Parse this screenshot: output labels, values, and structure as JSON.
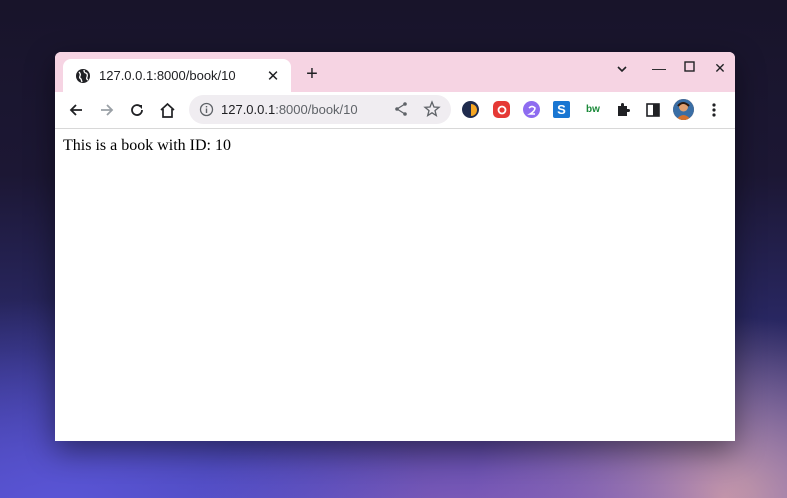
{
  "tab": {
    "title": "127.0.0.1:8000/book/10",
    "favicon": "globe-icon",
    "close_glyph": "✕"
  },
  "newtab_glyph": "+",
  "window_controls": {
    "dropdown": "chevron-down-icon",
    "minimize": "—",
    "maximize": "▢",
    "close": "✕"
  },
  "toolbar": {
    "back": "back-arrow-icon",
    "forward": "forward-arrow-icon",
    "reload": "reload-icon",
    "home": "home-icon"
  },
  "omnibox": {
    "host": "127.0.0.1",
    "path": ":8000/book/10"
  },
  "extensions": [
    {
      "name": "extension-1-icon",
      "color": "#1f2b4d"
    },
    {
      "name": "extension-2-icon",
      "color": "#e53935"
    },
    {
      "name": "extension-3-icon",
      "color": "#8e6cf0"
    },
    {
      "name": "extension-4-icon",
      "color": "#1976d2",
      "label": "S"
    },
    {
      "name": "extension-5-icon",
      "color": "#1b8a3a",
      "label": "bw"
    }
  ],
  "page": {
    "text": "This is a book with ID: 10"
  },
  "colors": {
    "tabstrip": "#f6d4e3",
    "omnibox": "#f0edf1"
  }
}
